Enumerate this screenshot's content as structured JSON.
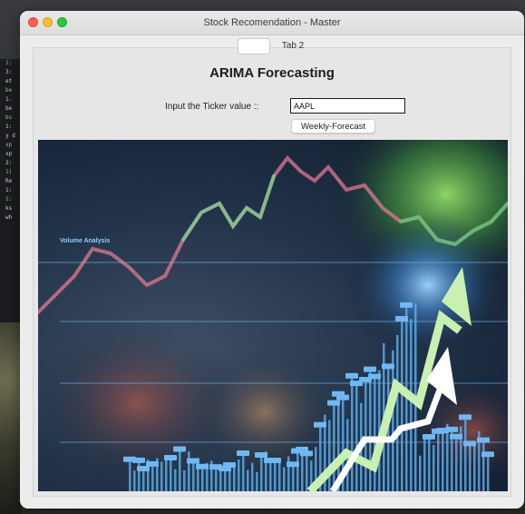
{
  "window": {
    "title": "Stock Recomendation - Master"
  },
  "tabs": [
    {
      "label": ""
    },
    {
      "label": "Tab 2"
    }
  ],
  "main": {
    "heading": "ARIMA Forecasting",
    "input_label": "Input the Ticker value ::",
    "ticker_value": "AAPL",
    "forecast_button": "Weekly-Forecast"
  },
  "image": {
    "label": "Volume Analysis"
  },
  "terminal_lines": [
    "1:",
    "3:",
    "et",
    "be",
    "1.",
    "be",
    "bs",
    "1:",
    "y d",
    "xp",
    "xp",
    "2:",
    "1)",
    "Re",
    "1:",
    "1:",
    "ks",
    "wh"
  ],
  "colors": {
    "accent_green": "#c9f0b0",
    "arrow_white": "#ffffff",
    "bar_blue": "#5aa9e6"
  }
}
